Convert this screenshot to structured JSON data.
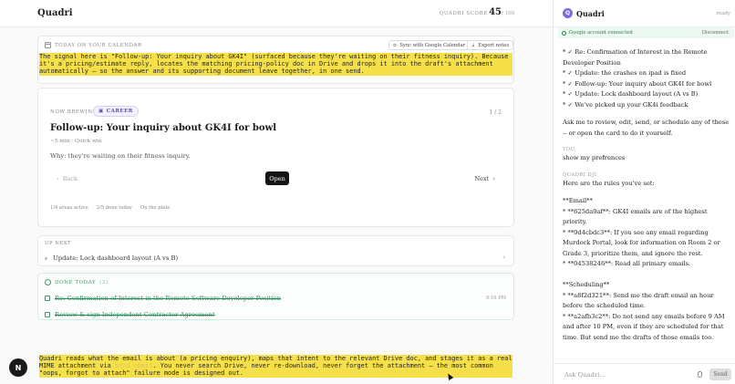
{
  "header": {
    "brand": "Quadri",
    "score_label": "QUADRI SCORE",
    "score_value": "45",
    "score_max": "/ 100"
  },
  "calendar": {
    "label": "TODAY ON YOUR CALENDAR",
    "sync_label": "Sync with Google Calendar",
    "export_label": "Export notes"
  },
  "annotations": {
    "top_a": "The signal here is \"Follow-up: Your inquiry about GK4I\" (surfaced because they're waiting on their fitness inquiry). Because it's a pricing/estimate reply, ",
    "top_blur": "                    ",
    "top_b": " locates the matching pricing-policy doc in Drive and drops it into the draft's attachment automatically — so the answer and its supporting document leave together, in one send.",
    "bottom_a": "Quadri reads what the email is about (a pricing enquiry), maps that intent to the relevant Drive doc, and stages it as a real MIME attachment via ",
    "bottom_blur": "send_email",
    "bottom_b": ". You never search Drive, never re-download, never forget the attachment — the most common \"oops, forgot to attach\" failure mode is designed out."
  },
  "now_brewing": {
    "label": "NOW BREWING",
    "tag": "CAREER",
    "pager": "1 / 2",
    "title": "Follow-up: Your inquiry about GK4I for bowl",
    "meta": "~5 min · Quick win",
    "why": "Why: they're waiting on their fitness inquiry.",
    "back_label": "Back",
    "open_label": "Open",
    "next_label": "Next",
    "stats": [
      "1/4 areas active",
      "2/5 done today",
      "On the plate"
    ]
  },
  "up_next": {
    "label": "UP NEXT",
    "item": "Update: Lock dashboard layout (A vs B)"
  },
  "done_today": {
    "label": "DONE TODAY",
    "count": "(2)",
    "items": [
      {
        "text": "Re: Confirmation of Interest in the Remote Software Developer Position",
        "time": "9:16 PM"
      },
      {
        "text": "Review & sign Independent Contractor Agreement",
        "time": ""
      }
    ]
  },
  "fab": {
    "label": "N"
  },
  "panel": {
    "avatar": "Q",
    "name": "Quadri",
    "status": "ready",
    "google_status": "Google account connected",
    "disconnect_label": "Disconnect",
    "chat_intro": "* ✓ Re: Confirmation of Interest in the Remote Developer Position\n* ✓ Update: the crashes on ipad is fixed\n* ✓ Follow-up: Your inquiry about GK4I for bowl\n* ✓ Update: Lock dashboard layout (A vs B)\n* ✓ We've picked up your GK4i feedback",
    "chat_prompt": "Ask me to review, edit, send, or schedule any of these -- or open the card to do it yourself.",
    "user_label": "YOU",
    "user_msg": "show my prefrences",
    "bot_label": "QUADRI  dji",
    "bot_intro": "Here are the rules you've set:",
    "rules": "**Email**\n* **625da9af**: GK4I emails are of the highest priority.\n* **9d4cbdc3**: If you see any email regarding Murdock Portal, look for information on Room 2 or Grade 3, prioritize them, and ignore the rest.\n* **04538246**: Read all primary emails.\n\n**Scheduling**\n* **a8f2d321**: Send me the draft email an hour before the scheduled time.\n* **a2afb3c2**: Do not send any emails before 9 AM and after 10 PM, even if they are scheduled for that time. But send me the drafts of those emails too.",
    "input_placeholder": "Ask Quadri…",
    "send_label": "Send"
  }
}
